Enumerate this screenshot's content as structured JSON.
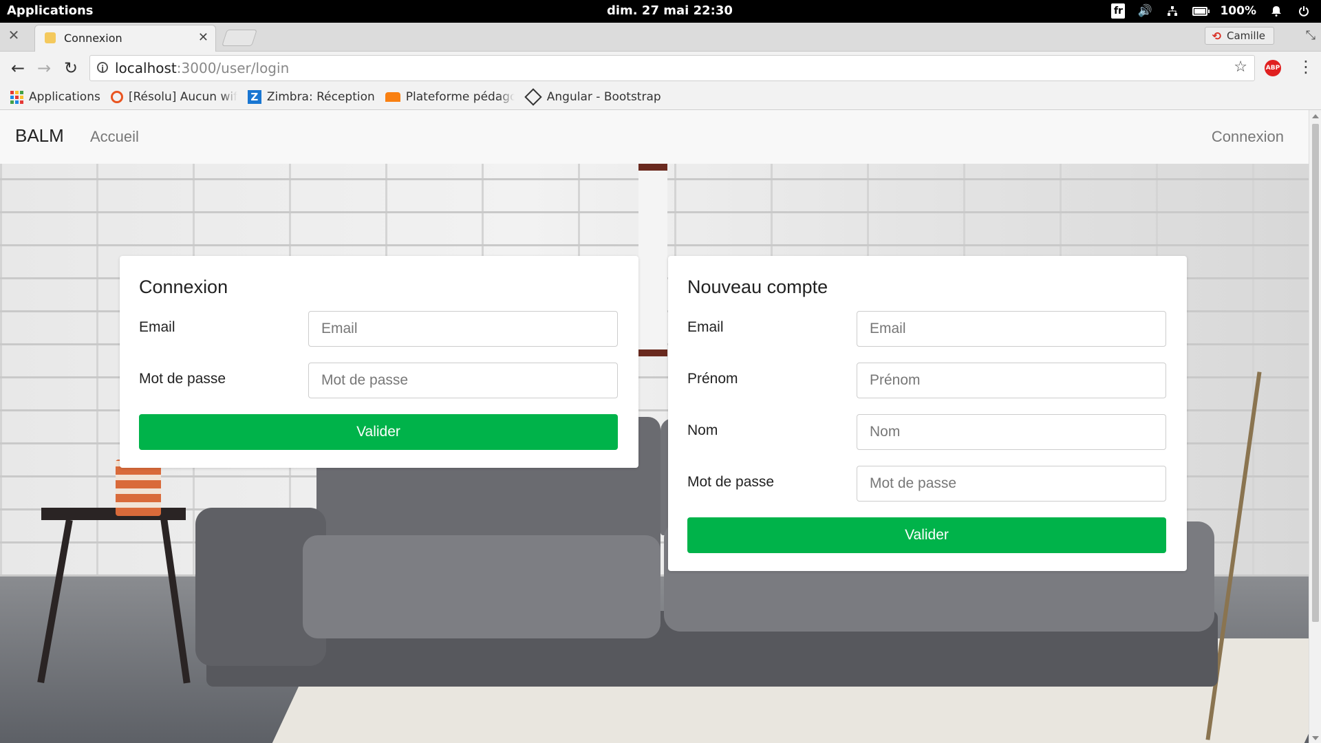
{
  "os": {
    "applications_label": "Applications",
    "clock": "dim. 27 mai   22:30",
    "lang": "fr",
    "battery": "100%"
  },
  "browser": {
    "tab_title": "Connexion",
    "profile_name": "Camille",
    "url_host": "localhost",
    "url_path": ":3000/user/login",
    "abp_label": "ABP",
    "bookmarks": [
      {
        "label": "Applications"
      },
      {
        "label": "[Résolu] Aucun wifi |"
      },
      {
        "label": "Zimbra: Réception"
      },
      {
        "label": "Plateforme pédagog"
      },
      {
        "label": "Angular - Bootstrap"
      }
    ]
  },
  "page": {
    "brand": "BALM",
    "nav_home": "Accueil",
    "nav_login": "Connexion",
    "login_card": {
      "title": "Connexion",
      "email_label": "Email",
      "email_placeholder": "Email",
      "password_label": "Mot de passe",
      "password_placeholder": "Mot de passe",
      "submit": "Valider"
    },
    "signup_card": {
      "title": "Nouveau compte",
      "email_label": "Email",
      "email_placeholder": "Email",
      "firstname_label": "Prénom",
      "firstname_placeholder": "Prénom",
      "lastname_label": "Nom",
      "lastname_placeholder": "Nom",
      "password_label": "Mot de passe",
      "password_placeholder": "Mot de passe",
      "submit": "Valider"
    }
  },
  "colors": {
    "accent_green": "#00b34a",
    "navbar_bg": "#f8f8f8"
  }
}
